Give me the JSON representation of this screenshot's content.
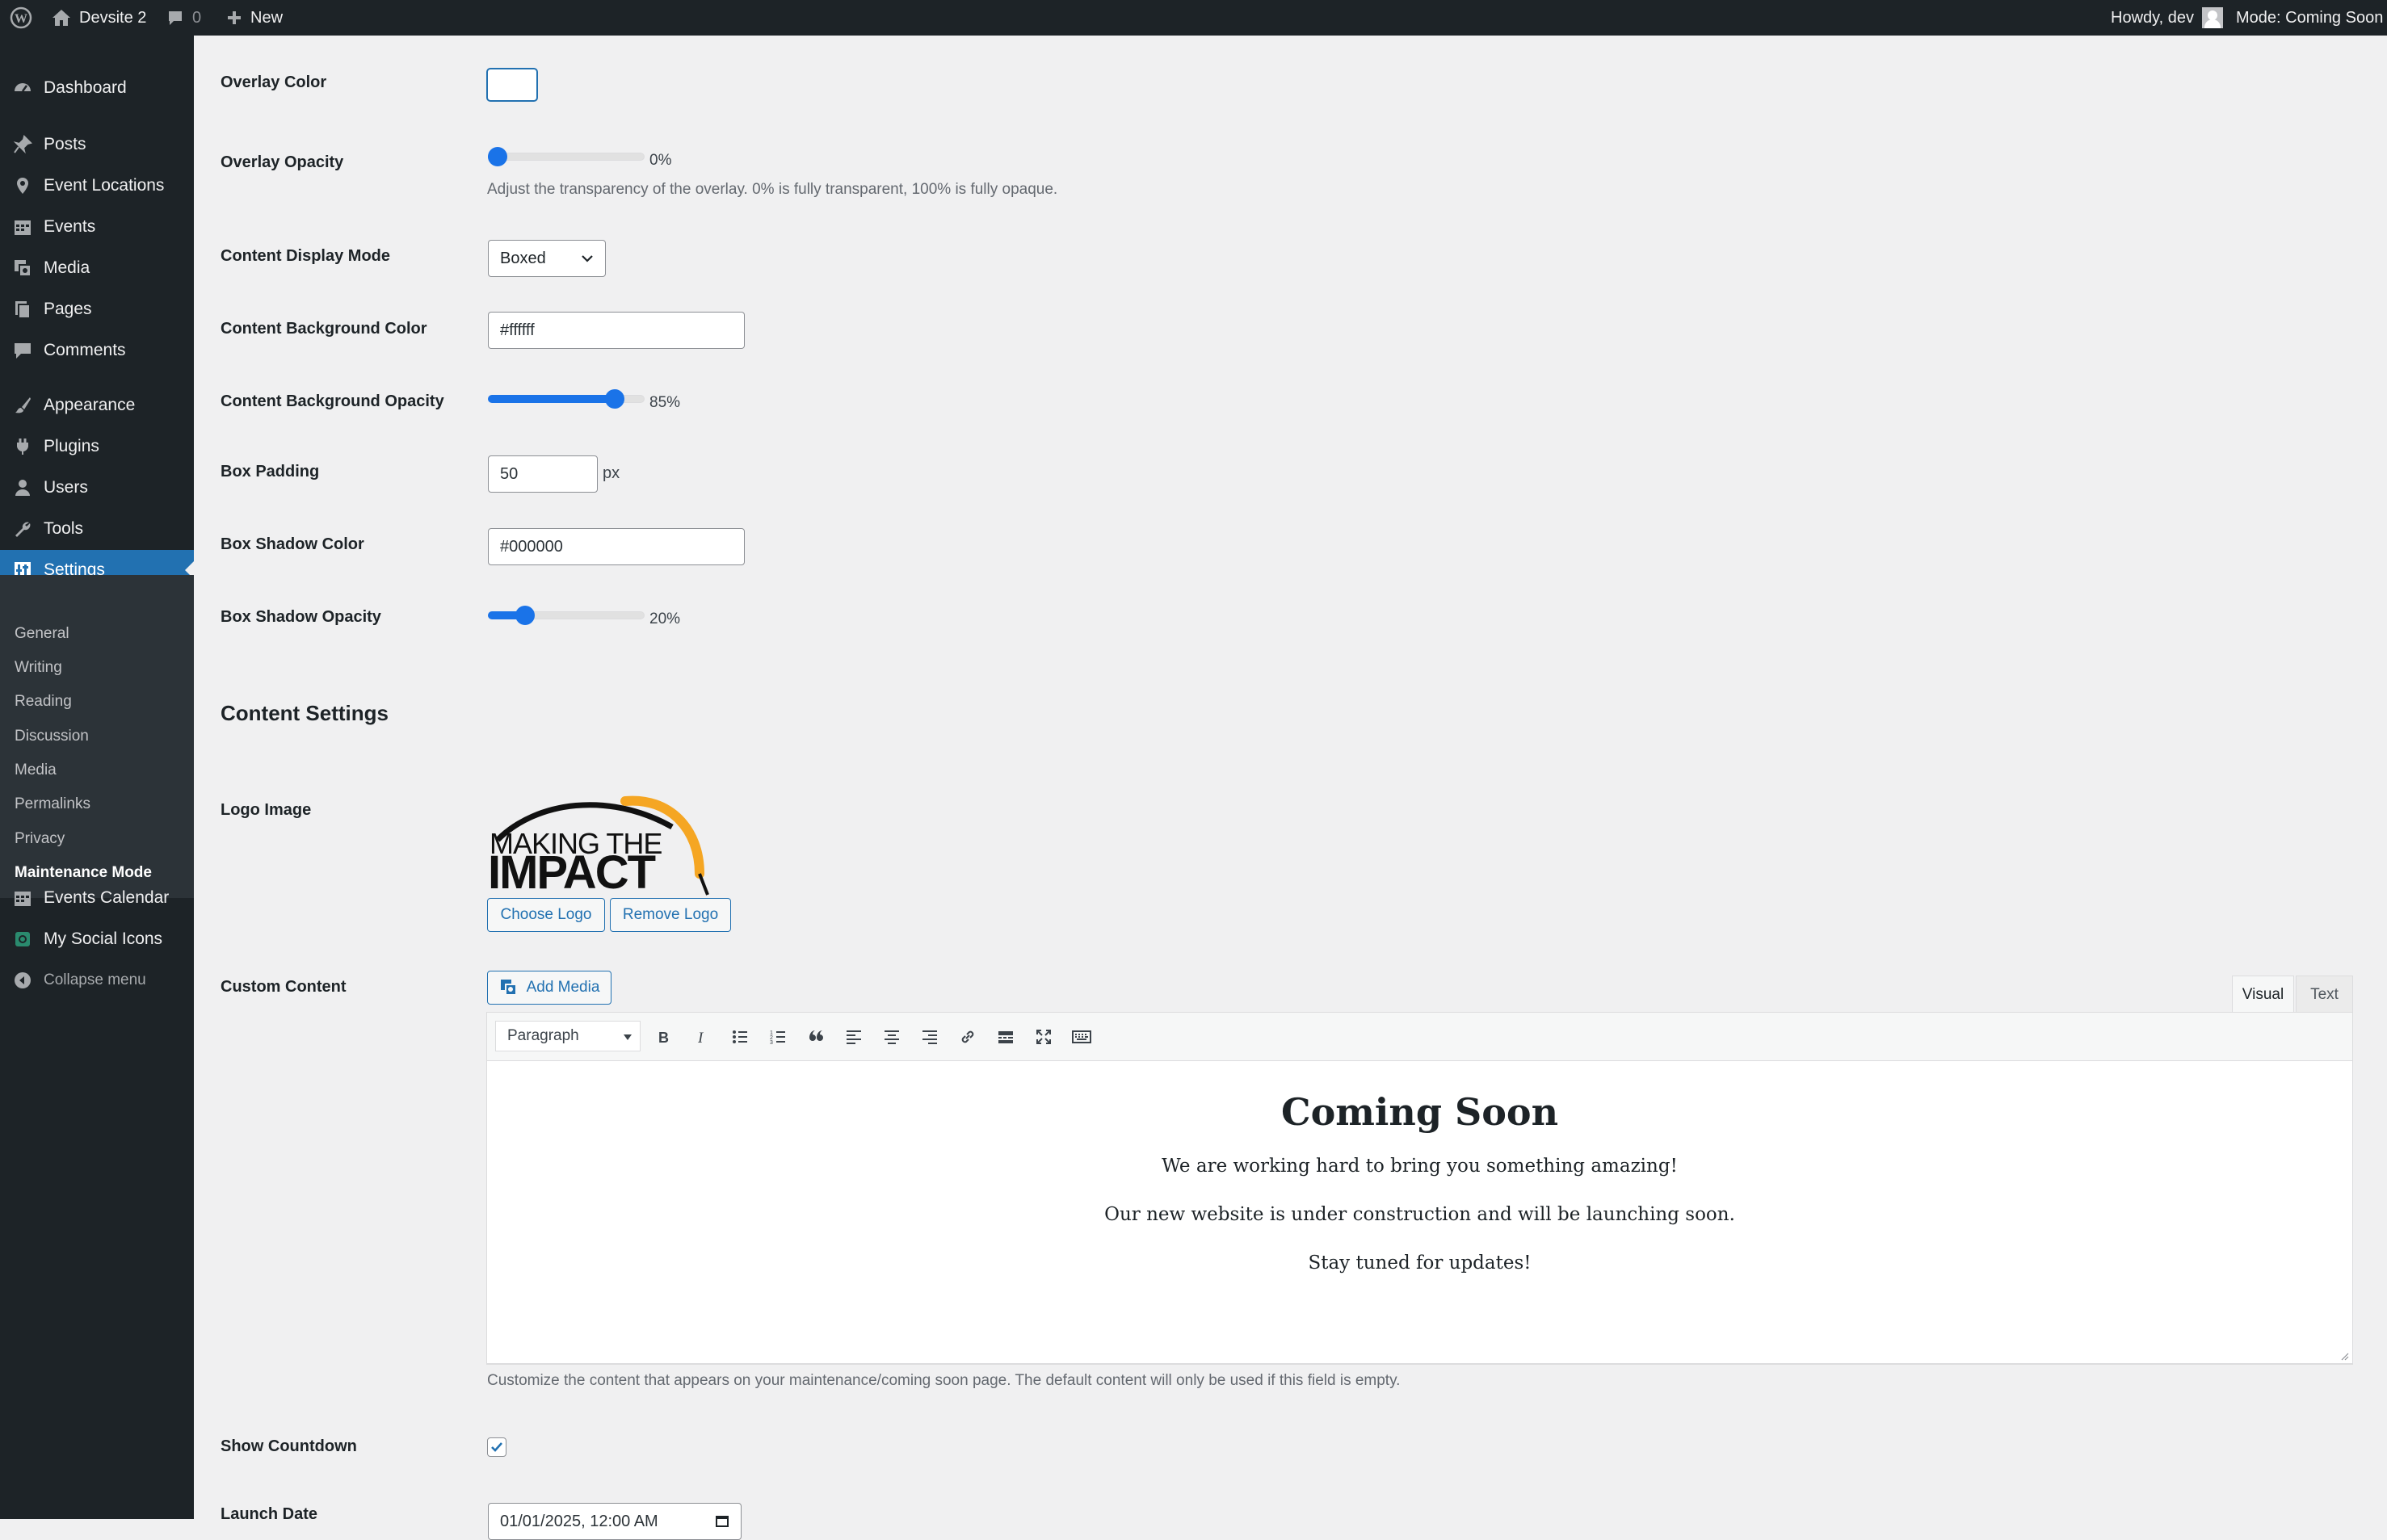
{
  "adminbar": {
    "site_name": "Devsite 2",
    "comments_count": "0",
    "new_label": "New",
    "howdy": "Howdy, dev",
    "mode": "Mode: Coming Soon"
  },
  "sidebar": {
    "items": [
      {
        "label": "Dashboard",
        "icon": "dashboard-icon"
      },
      {
        "label": "Posts",
        "icon": "pin-icon"
      },
      {
        "label": "Event Locations",
        "icon": "location-icon"
      },
      {
        "label": "Events",
        "icon": "calendar-icon"
      },
      {
        "label": "Media",
        "icon": "media-icon"
      },
      {
        "label": "Pages",
        "icon": "pages-icon"
      },
      {
        "label": "Comments",
        "icon": "comment-icon"
      },
      {
        "label": "Appearance",
        "icon": "brush-icon"
      },
      {
        "label": "Plugins",
        "icon": "plugin-icon"
      },
      {
        "label": "Users",
        "icon": "user-icon"
      },
      {
        "label": "Tools",
        "icon": "wrench-icon"
      },
      {
        "label": "Settings",
        "icon": "settings-icon"
      }
    ],
    "submenu": [
      "General",
      "Writing",
      "Reading",
      "Discussion",
      "Media",
      "Permalinks",
      "Privacy",
      "Maintenance Mode"
    ],
    "extra": [
      {
        "label": "Events Calendar",
        "icon": "calendar-icon"
      },
      {
        "label": "My Social Icons",
        "icon": "social-icon"
      }
    ],
    "collapse": "Collapse menu"
  },
  "form": {
    "overlay_color": {
      "label": "Overlay Color",
      "value": "#ffffff"
    },
    "overlay_opacity": {
      "label": "Overlay Opacity",
      "value_text": "0%",
      "value": 0,
      "description": "Adjust the transparency of the overlay. 0% is fully transparent, 100% is fully opaque."
    },
    "content_display_mode": {
      "label": "Content Display Mode",
      "value": "Boxed"
    },
    "content_bg_color": {
      "label": "Content Background Color",
      "value": "#ffffff"
    },
    "content_bg_opacity": {
      "label": "Content Background Opacity",
      "value_text": "85%",
      "value": 85
    },
    "box_padding": {
      "label": "Box Padding",
      "value": "50",
      "unit": "px"
    },
    "box_shadow_color": {
      "label": "Box Shadow Color",
      "value": "#000000"
    },
    "box_shadow_opacity": {
      "label": "Box Shadow Opacity",
      "value_text": "20%",
      "value": 20
    }
  },
  "content_settings": {
    "title": "Content Settings",
    "logo": {
      "label": "Logo Image",
      "line1": "MAKING THE",
      "line2": "IMPACT",
      "choose": "Choose Logo",
      "remove": "Remove Logo"
    },
    "custom_content": {
      "label": "Custom Content",
      "add_media": "Add Media",
      "tab_visual": "Visual",
      "tab_text": "Text",
      "format": "Paragraph",
      "heading": "Coming Soon",
      "paragraphs": [
        "We are working hard to bring you something amazing!",
        "Our new website is under construction and will be launching soon.",
        "Stay tuned for updates!"
      ],
      "description": "Customize the content that appears on your maintenance/coming soon page. The default content will only be used if this field is empty."
    },
    "show_countdown": {
      "label": "Show Countdown",
      "checked": true
    },
    "launch_date": {
      "label": "Launch Date",
      "value": "01/01/2025, 12:00 AM"
    }
  },
  "colors": {
    "accent": "#2271b1",
    "slider": "#1a73e8",
    "sidebar": "#1d2327",
    "logo_orange": "#f5a623"
  }
}
